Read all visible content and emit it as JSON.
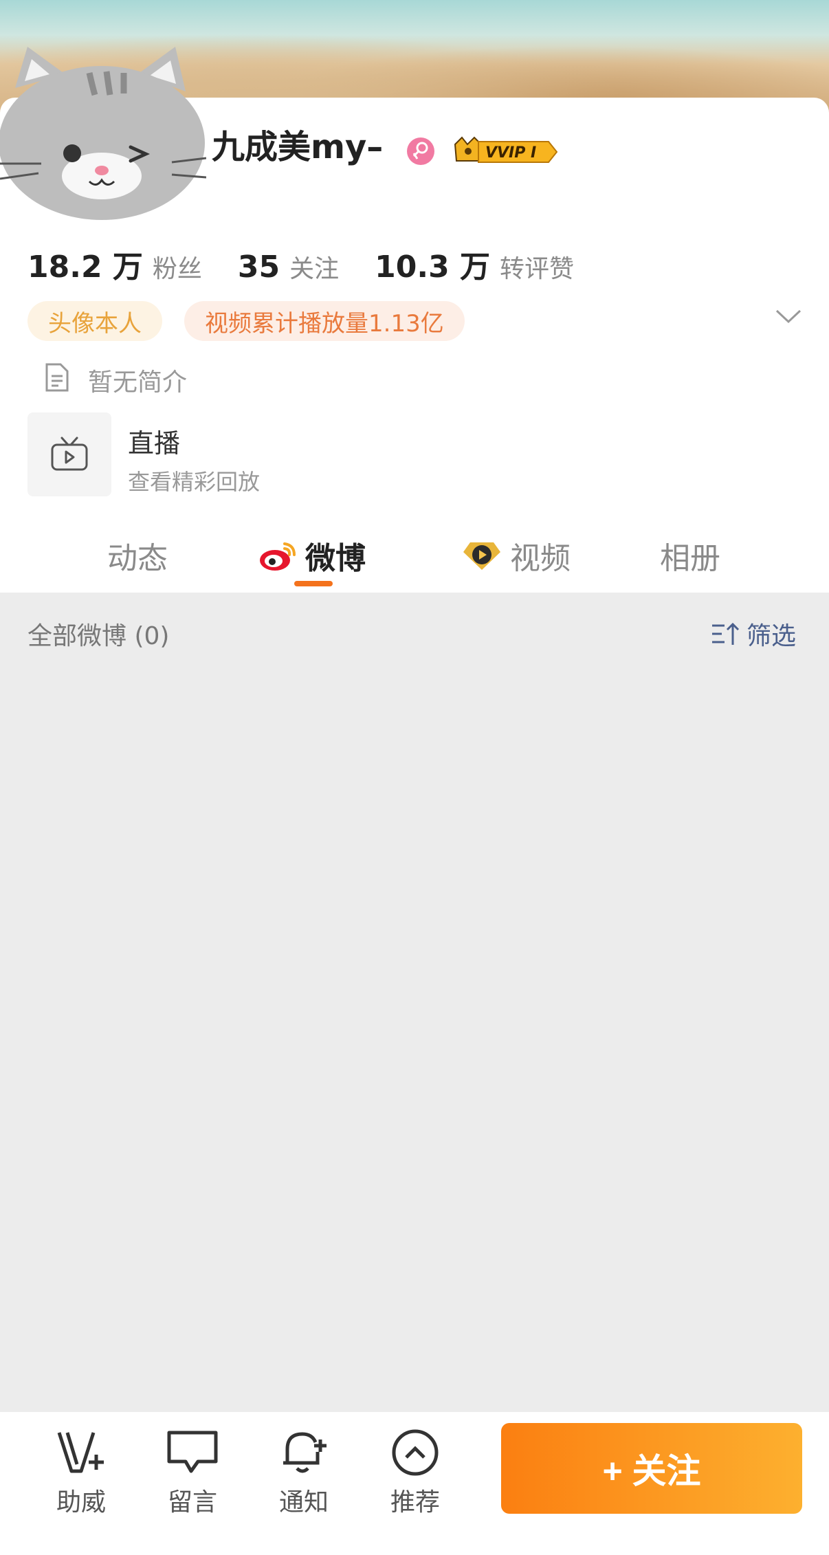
{
  "profile": {
    "name": "九成美my–",
    "vip_label": "VVIP I"
  },
  "stats": [
    {
      "value": "18.2 万",
      "label": "粉丝"
    },
    {
      "value": "35",
      "label": "关注"
    },
    {
      "value": "10.3 万",
      "label": "转评赞"
    }
  ],
  "tags": {
    "tag1": "头像本人",
    "tag2": "视频累计播放量1.13亿"
  },
  "bio": "暂无简介",
  "live": {
    "title": "直播",
    "subtitle": "查看精彩回放"
  },
  "tabs": [
    {
      "label": "动态"
    },
    {
      "label": "微博"
    },
    {
      "label": "视频"
    },
    {
      "label": "相册"
    }
  ],
  "feed": {
    "header": "全部微博 (0)",
    "filter_label": "筛选"
  },
  "bottom_bar": {
    "items": [
      {
        "label": "助威"
      },
      {
        "label": "留言"
      },
      {
        "label": "通知"
      },
      {
        "label": "推荐"
      }
    ],
    "follow_label": "+ 关注"
  },
  "colors": {
    "accent": "#f4721c",
    "follow_start": "#fb7f11",
    "follow_end": "#fdb02f",
    "filter": "#4a5f8c"
  }
}
